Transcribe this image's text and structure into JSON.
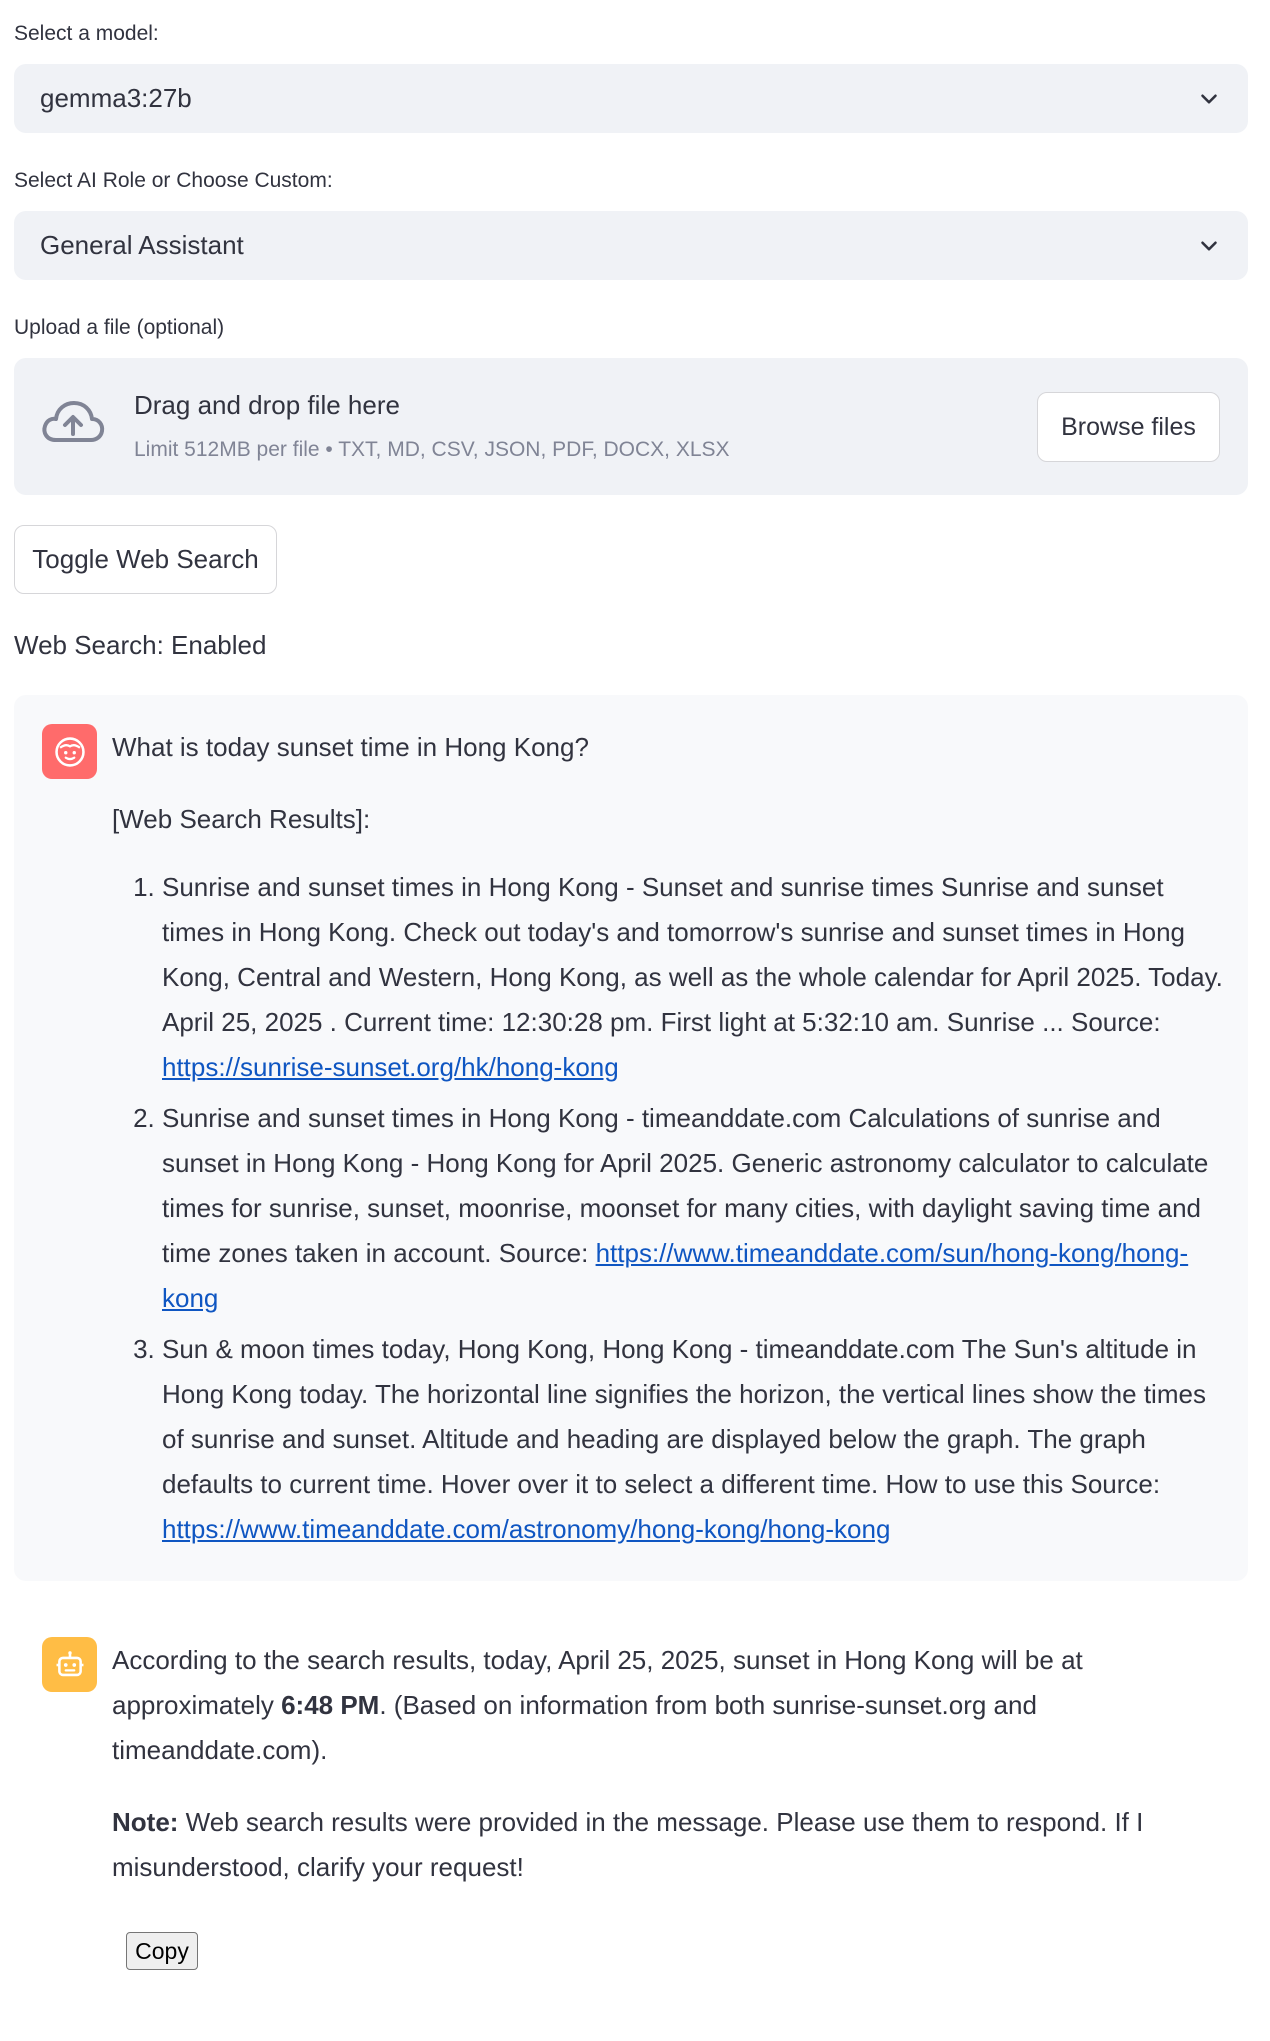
{
  "model_select": {
    "label": "Select a model:",
    "value": "gemma3:27b"
  },
  "role_select": {
    "label": "Select AI Role or Choose Custom:",
    "value": "General Assistant"
  },
  "upload": {
    "label": "Upload a file (optional)",
    "title": "Drag and drop file here",
    "subtitle": "Limit 512MB per file • TXT, MD, CSV, JSON, PDF, DOCX, XLSX",
    "browse_label": "Browse files"
  },
  "toggle_label": "Toggle Web Search",
  "status_text": "Web Search: Enabled",
  "user_message": {
    "question": "What is today sunset time in Hong Kong?",
    "results_header": "[Web Search Results]:",
    "results": [
      {
        "text": "Sunrise and sunset times in Hong Kong - Sunset and sunrise times Sunrise and sunset times in Hong Kong. Check out today's and tomorrow's sunrise and sunset times in Hong Kong, Central and Western, Hong Kong, as well as the whole calendar for April 2025. Today. April 25, 2025 . Current time: 12:30:28 pm. First light at 5:32:10 am. Sunrise ... Source: ",
        "link": "https://sunrise-sunset.org/hk/hong-kong"
      },
      {
        "text": "Sunrise and sunset times in Hong Kong - timeanddate.com Calculations of sunrise and sunset in Hong Kong - Hong Kong for April 2025. Generic astronomy calculator to calculate times for sunrise, sunset, moonrise, moonset for many cities, with daylight saving time and time zones taken in account. Source: ",
        "link": "https://www.timeanddate.com/sun/hong-kong/hong-kong"
      },
      {
        "text": "Sun & moon times today, Hong Kong, Hong Kong - timeanddate.com The Sun's altitude in Hong Kong today. The horizontal line signifies the horizon, the vertical lines show the times of sunrise and sunset. Altitude and heading are displayed below the graph. The graph defaults to current time. Hover over it to select a different time. How to use this Source: ",
        "link": "https://www.timeanddate.com/astronomy/hong-kong/hong-kong"
      }
    ]
  },
  "bot_message": {
    "text_before": "According to the search results, today, April 25, 2025, sunset in Hong Kong will be at approximately ",
    "time_bold": "6:48 PM",
    "text_after": ". (Based on information from both sunrise-sunset.org and timeanddate.com).",
    "note_label": "Note:",
    "note_text": " Web search results were provided in the message. Please use them to respond. If I misunderstood, clarify your request!"
  },
  "copy_label": "Copy",
  "colors": {
    "user_avatar": "#ff6b6b",
    "bot_avatar": "#ffbd45",
    "link": "#0f56c2"
  },
  "icons": {
    "user": "face-icon",
    "bot": "robot-icon",
    "upload": "cloud-upload-icon"
  }
}
